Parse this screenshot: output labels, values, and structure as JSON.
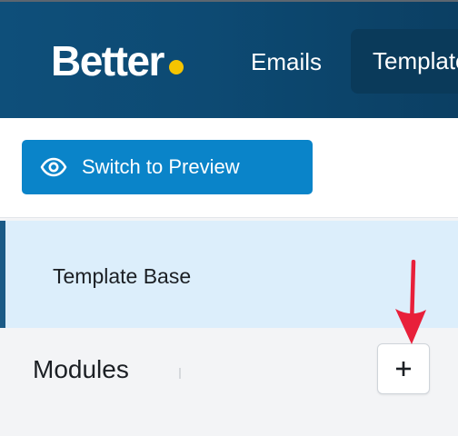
{
  "colors": {
    "brand_dot": "#f5c400",
    "topbar": "#0d4a73",
    "nav_active_bg": "#0a3a5a",
    "primary_button": "#0a84c9",
    "selected_item_bg": "#dceefb",
    "selected_item_border": "#1a5a86",
    "annotation_arrow": "#e8203a"
  },
  "header": {
    "brand": "Better",
    "nav": {
      "emails": "Emails",
      "templates": "Templates"
    }
  },
  "toolbar": {
    "preview_button": {
      "label": "Switch to Preview",
      "icon": "eye-icon"
    }
  },
  "sidebar": {
    "selected_item": "Template Base",
    "modules": {
      "title": "Modules",
      "add_icon": "plus-icon"
    }
  },
  "annotation": {
    "icon": "red-arrow-down"
  }
}
